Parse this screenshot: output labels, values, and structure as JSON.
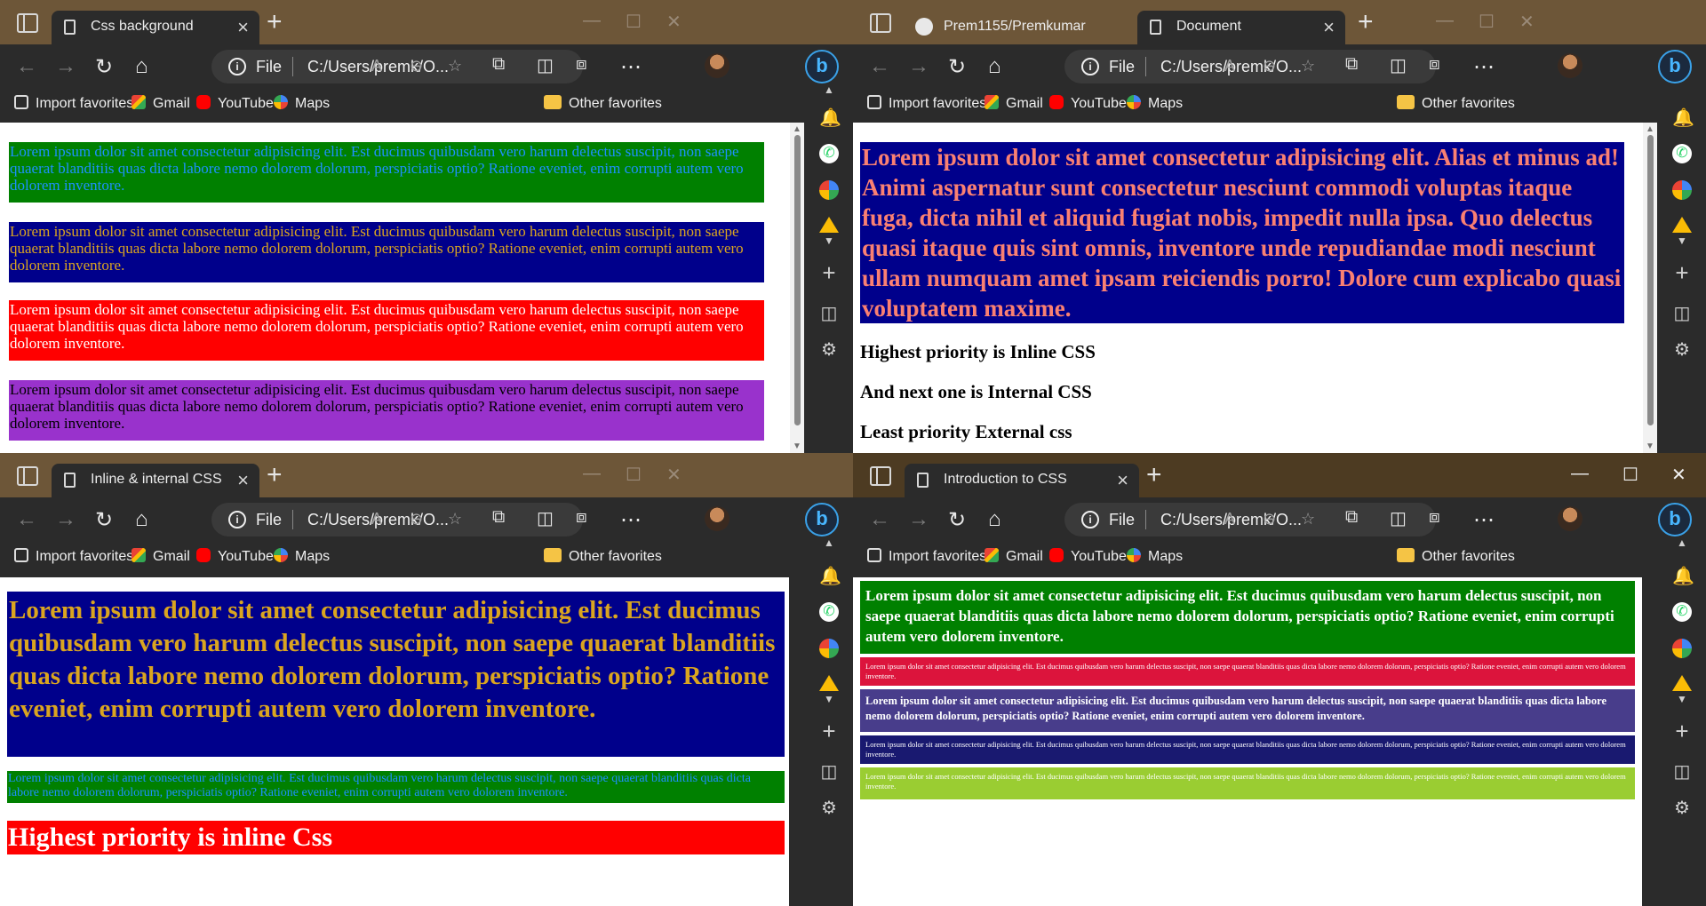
{
  "windows": [
    {
      "tabs": [
        {
          "title": "Css background"
        }
      ],
      "address": {
        "scheme": "File",
        "path": "C:/Users/premk/O..."
      },
      "content": {
        "blocks": [
          {
            "text": "Lorem ipsum dolor sit amet consectetur adipisicing elit. Est ducimus quibusdam vero harum delectus suscipit, non saepe quaerat blanditiis quas dicta labore nemo dolorem dolorum, perspiciatis optio? Ratione eveniet, enim corrupti autem vero dolorem inventore.",
            "bg": "#008000",
            "color": "#1e90ff"
          },
          {
            "text": "Lorem ipsum dolor sit amet consectetur adipisicing elit. Est ducimus quibusdam vero harum delectus suscipit, non saepe quaerat blanditiis quas dicta labore nemo dolorem dolorum, perspiciatis optio? Ratione eveniet, enim corrupti autem vero dolorem inventore.",
            "bg": "#00008b",
            "color": "#daa520"
          },
          {
            "text": "Lorem ipsum dolor sit amet consectetur adipisicing elit. Est ducimus quibusdam vero harum delectus suscipit, non saepe quaerat blanditiis quas dicta labore nemo dolorem dolorum, perspiciatis optio? Ratione eveniet, enim corrupti autem vero dolorem inventore.",
            "bg": "#ff0000",
            "color": "#ffffff"
          },
          {
            "text": "Lorem ipsum dolor sit amet consectetur adipisicing elit. Est ducimus quibusdam vero harum delectus suscipit, non saepe quaerat blanditiis quas dicta labore nemo dolorem dolorum, perspiciatis optio? Ratione eveniet, enim corrupti autem vero dolorem inventore.",
            "bg": "#9932cc",
            "color": "#000000"
          }
        ],
        "scroll_fraction": 0.95
      }
    },
    {
      "tabs": [
        {
          "title": "Prem1155/Premkumar"
        },
        {
          "title": "Document"
        }
      ],
      "address": {
        "scheme": "File",
        "path": "C:/Users/premk/O..."
      },
      "content": {
        "blocks": [
          {
            "text": "Lorem ipsum dolor sit amet consectetur adipisicing elit. Alias et minus ad! Animi aspernatur sunt consectetur nesciunt commodi voluptas itaque fuga, dicta nihil et aliquid fugiat nobis, impedit nulla ipsa. Quo delectus quasi itaque quis sint omnis, inventore unde repudiandae modi nesciunt ullam numquam amet ipsam reiciendis porro! Dolore cum explicabo quasi voluptatem maxime.",
            "bg": "#00008b",
            "color": "#fa8072"
          }
        ],
        "lines": [
          "Highest priority is Inline CSS",
          "And next one is Internal CSS",
          "Least priority External css"
        ],
        "scroll_fraction": 0.95
      }
    },
    {
      "tabs": [
        {
          "title": "Inline & internal CSS"
        }
      ],
      "address": {
        "scheme": "File",
        "path": "C:/Users/premk/O..."
      },
      "content": {
        "blocks": [
          {
            "text": "Lorem ipsum dolor sit amet consectetur adipisicing elit. Est ducimus quibusdam vero harum delectus suscipit, non saepe quaerat blanditiis quas dicta labore nemo dolorem dolorum, perspiciatis optio? Ratione eveniet, enim corrupti autem vero dolorem inventore.",
            "bg": "#00008b",
            "color": "#daa520"
          },
          {
            "text": "Lorem ipsum dolor sit amet consectetur adipisicing elit. Est ducimus quibusdam vero harum delectus suscipit, non saepe quaerat blanditiis quas dicta labore nemo dolorem dolorum, perspiciatis optio? Ratione eveniet, enim corrupti autem vero dolorem inventore.",
            "bg": "#008000",
            "color": "#1e90ff"
          },
          {
            "text": "Highest priority is inline Css",
            "bg": "#ff0000",
            "color": "#ffffff"
          }
        ]
      }
    },
    {
      "tabs": [
        {
          "title": "Introduction to CSS"
        }
      ],
      "address": {
        "scheme": "File",
        "path": "C:/Users/premk/O..."
      },
      "content": {
        "blocks": [
          {
            "text": "Lorem ipsum dolor sit amet consectetur adipisicing elit. Est ducimus quibusdam vero harum delectus suscipit, non saepe quaerat blanditiis quas dicta labore nemo dolorem dolorum, perspiciatis optio? Ratione eveniet, enim corrupti autem vero dolorem inventore.",
            "bg": "#008000",
            "color": "#ffffff"
          },
          {
            "text": "Lorem ipsum dolor sit amet consectetur adipisicing elit. Est ducimus quibusdam vero harum delectus suscipit, non saepe quaerat blanditiis quas dicta labore nemo dolorem dolorum, perspiciatis optio? Ratione eveniet, enim corrupti autem vero dolorem inventore.",
            "bg": "#dc143c",
            "color": "#ffffff"
          },
          {
            "text": "Lorem ipsum dolor sit amet consectetur adipisicing elit. Est ducimus quibusdam vero harum delectus suscipit, non saepe quaerat blanditiis quas dicta labore nemo dolorem dolorum, perspiciatis optio? Ratione eveniet, enim corrupti autem vero dolorem inventore.",
            "bg": "#483d8b",
            "color": "#ffffff"
          },
          {
            "text": "Lorem ipsum dolor sit amet consectetur adipisicing elit. Est ducimus quibusdam vero harum delectus suscipit, non saepe quaerat blanditiis quas dicta labore nemo dolorem dolorum, perspiciatis optio? Ratione eveniet, enim corrupti autem vero dolorem inventore.",
            "bg": "#191970",
            "color": "#ffffff"
          },
          {
            "text": "Lorem ipsum dolor sit amet consectetur adipisicing elit. Est ducimus quibusdam vero harum delectus suscipit, non saepe quaerat blanditiis quas dicta labore nemo dolorem dolorum, perspiciatis optio? Ratione eveniet, enim corrupti autem vero dolorem inventore.",
            "bg": "#9acd32",
            "color": "#ffffff"
          }
        ]
      }
    }
  ],
  "favorites": {
    "import": "Import favorites",
    "items": [
      {
        "label": "Gmail",
        "icon": "gmail-icon"
      },
      {
        "label": "YouTube",
        "icon": "youtube-icon"
      },
      {
        "label": "Maps",
        "icon": "maps-icon"
      }
    ],
    "other": "Other favorites"
  },
  "icons": {
    "sidebar": [
      "bell-icon",
      "whatsapp-icon",
      "google-icon",
      "drive-icon",
      "chevron-down-icon",
      "plus-icon",
      "split-screen-icon",
      "gear-icon"
    ],
    "bing": "b"
  }
}
